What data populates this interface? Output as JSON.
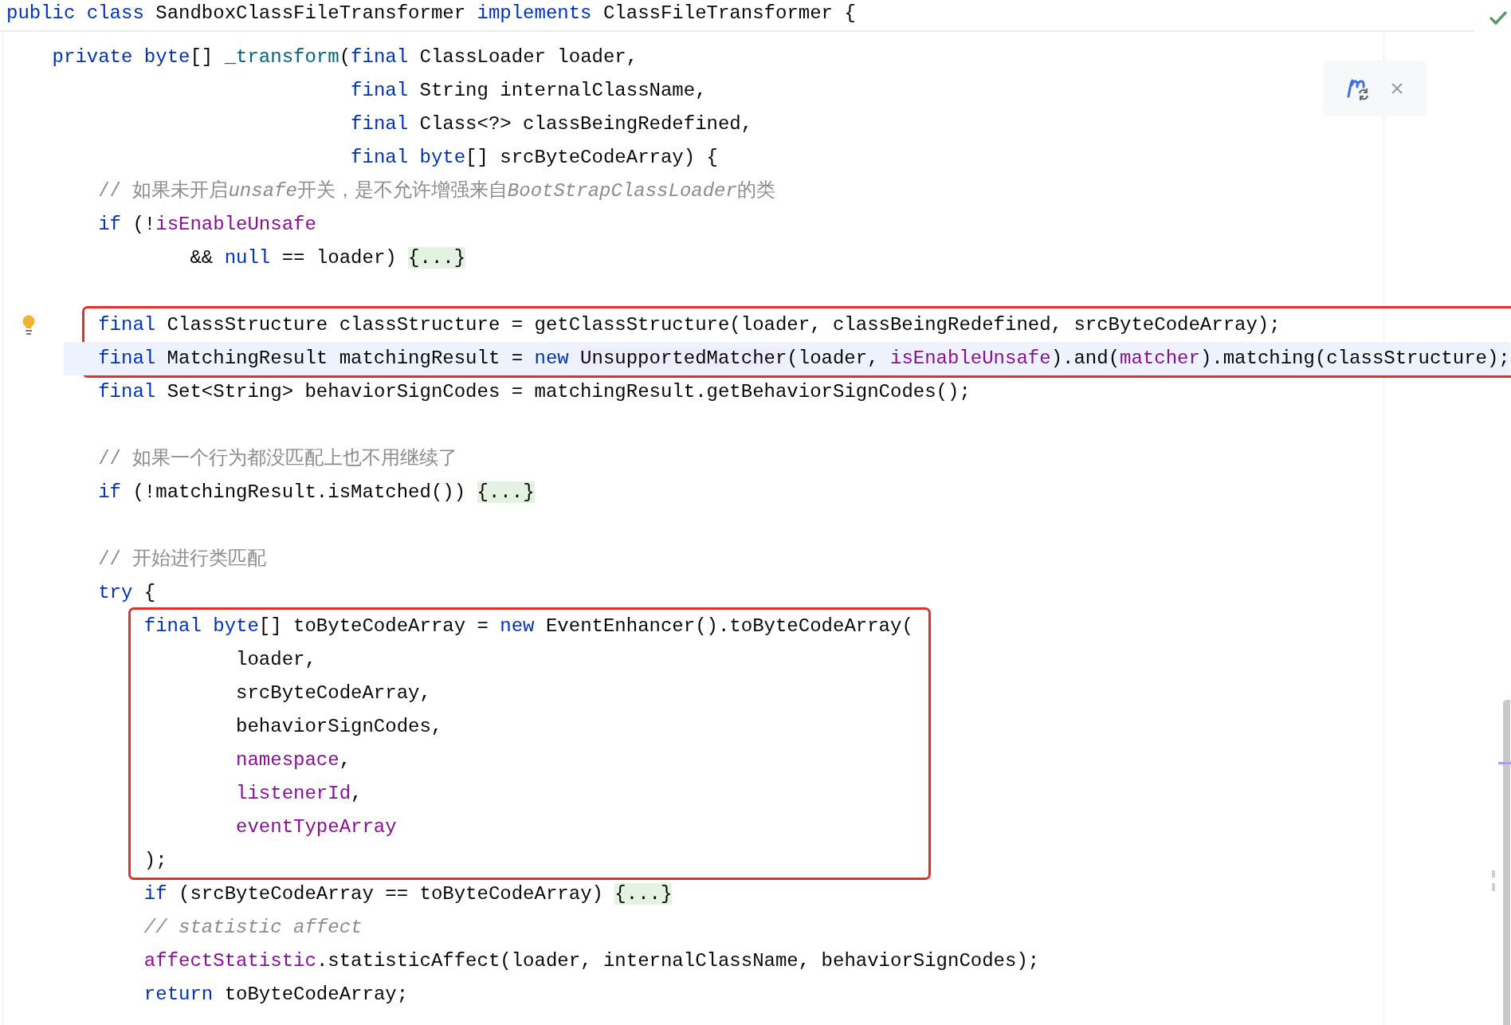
{
  "header": {
    "tokens": [
      {
        "kind": "keyword",
        "text": "public class "
      },
      {
        "kind": "text",
        "text": "SandboxClassFileTransformer "
      },
      {
        "kind": "keyword",
        "text": "implements "
      },
      {
        "kind": "text",
        "text": "ClassFileTransformer {"
      }
    ]
  },
  "rows": [
    {
      "kind": "line",
      "current": false,
      "tokens": [
        {
          "kind": "keyword",
          "text": "    private byte"
        },
        {
          "kind": "text",
          "text": "[] "
        },
        {
          "kind": "method",
          "text": "_transform"
        },
        {
          "kind": "text",
          "text": "("
        },
        {
          "kind": "keyword",
          "text": "final "
        },
        {
          "kind": "text",
          "text": "ClassLoader loader,"
        }
      ]
    },
    {
      "kind": "line",
      "current": false,
      "tokens": [
        {
          "kind": "keyword",
          "text": "                              final "
        },
        {
          "kind": "text",
          "text": "String internalClassName,"
        }
      ]
    },
    {
      "kind": "line",
      "current": false,
      "tokens": [
        {
          "kind": "keyword",
          "text": "                              final "
        },
        {
          "kind": "text",
          "text": "Class<?> classBeingRedefined,"
        }
      ]
    },
    {
      "kind": "line",
      "current": false,
      "tokens": [
        {
          "kind": "keyword",
          "text": "                              final byte"
        },
        {
          "kind": "text",
          "text": "[] srcByteCodeArray) {"
        }
      ]
    },
    {
      "kind": "line",
      "current": false,
      "tokens": [
        {
          "kind": "comment",
          "text": "        // 如果未开启"
        },
        {
          "kind": "comment_italic",
          "text": "unsafe"
        },
        {
          "kind": "comment",
          "text": "开关，是不允许增强来自"
        },
        {
          "kind": "comment_italic",
          "text": "BootStrapClassLoader"
        },
        {
          "kind": "comment",
          "text": "的类"
        }
      ]
    },
    {
      "kind": "line",
      "current": false,
      "tokens": [
        {
          "kind": "keyword",
          "text": "        if"
        },
        {
          "kind": "text",
          "text": " (!"
        },
        {
          "kind": "field",
          "text": "isEnableUnsafe"
        }
      ]
    },
    {
      "kind": "line",
      "current": false,
      "tokens": [
        {
          "kind": "text",
          "text": "                && "
        },
        {
          "kind": "keyword",
          "text": "null"
        },
        {
          "kind": "text",
          "text": " == loader) "
        },
        {
          "kind": "fold",
          "text": "{...}"
        }
      ]
    },
    {
      "kind": "blank"
    },
    {
      "kind": "box",
      "lines": [
        {
          "current": false,
          "bulb": true,
          "tokens": [
            {
              "kind": "keyword",
              "text": "        final"
            },
            {
              "kind": "text",
              "text": " ClassStructure classStructure = getClassStructure(loader, classBeingRedefined, srcByteCodeArray);"
            }
          ]
        },
        {
          "current": true,
          "tokens": [
            {
              "kind": "keyword",
              "text": "        final"
            },
            {
              "kind": "text",
              "text": " MatchingResult matchingResult = "
            },
            {
              "kind": "keyword",
              "text": "new "
            },
            {
              "kind": "usage",
              "text": "UnsupportedMatcher"
            },
            {
              "kind": "text",
              "text": "(loader, "
            },
            {
              "kind": "field",
              "text": "isEnableUnsafe"
            },
            {
              "kind": "text",
              "text": ").and("
            },
            {
              "kind": "field",
              "text": "matcher"
            },
            {
              "kind": "text",
              "text": ").matching(classStructure);"
            }
          ]
        }
      ]
    },
    {
      "kind": "line",
      "current": false,
      "tokens": [
        {
          "kind": "keyword",
          "text": "        final"
        },
        {
          "kind": "text",
          "text": " Set<String> behaviorSignCodes = matchingResult.getBehaviorSignCodes();"
        }
      ]
    },
    {
      "kind": "blank"
    },
    {
      "kind": "line",
      "current": false,
      "tokens": [
        {
          "kind": "comment",
          "text": "        // 如果一个行为都没匹配上也不用继续了"
        }
      ]
    },
    {
      "kind": "line",
      "current": false,
      "tokens": [
        {
          "kind": "keyword",
          "text": "        if"
        },
        {
          "kind": "text",
          "text": " (!matchingResult.isMatched()) "
        },
        {
          "kind": "fold",
          "text": "{...}"
        }
      ]
    },
    {
      "kind": "blank"
    },
    {
      "kind": "line",
      "current": false,
      "tokens": [
        {
          "kind": "comment",
          "text": "        // 开始进行类匹配"
        }
      ]
    },
    {
      "kind": "line",
      "current": false,
      "tokens": [
        {
          "kind": "keyword",
          "text": "        try"
        },
        {
          "kind": "text",
          "text": " {"
        }
      ]
    },
    {
      "kind": "box",
      "lines": [
        {
          "current": false,
          "tokens": [
            {
              "kind": "keyword",
              "text": "            final byte"
            },
            {
              "kind": "text",
              "text": "[] toByteCodeArray = "
            },
            {
              "kind": "keyword",
              "text": "new"
            },
            {
              "kind": "text",
              "text": " EventEnhancer().toByteCodeArray("
            }
          ]
        },
        {
          "current": false,
          "tokens": [
            {
              "kind": "text",
              "text": "                    loader,"
            }
          ]
        },
        {
          "current": false,
          "tokens": [
            {
              "kind": "text",
              "text": "                    srcByteCodeArray,"
            }
          ]
        },
        {
          "current": false,
          "tokens": [
            {
              "kind": "text",
              "text": "                    behaviorSignCodes,"
            }
          ]
        },
        {
          "current": false,
          "tokens": [
            {
              "kind": "field",
              "text": "                    namespace"
            },
            {
              "kind": "text",
              "text": ","
            }
          ]
        },
        {
          "current": false,
          "tokens": [
            {
              "kind": "field",
              "text": "                    listenerId"
            },
            {
              "kind": "text",
              "text": ","
            }
          ]
        },
        {
          "current": false,
          "tokens": [
            {
              "kind": "field",
              "text": "                    eventTypeArray"
            }
          ]
        },
        {
          "current": false,
          "tokens": [
            {
              "kind": "text",
              "text": "            );"
            }
          ]
        }
      ]
    },
    {
      "kind": "line",
      "current": false,
      "tokens": [
        {
          "kind": "keyword",
          "text": "            if"
        },
        {
          "kind": "text",
          "text": " (srcByteCodeArray == toByteCodeArray) "
        },
        {
          "kind": "fold",
          "text": "{...}"
        }
      ]
    },
    {
      "kind": "line",
      "current": false,
      "tokens": [
        {
          "kind": "comment_italic",
          "text": "            // statistic affect"
        }
      ]
    },
    {
      "kind": "line",
      "current": false,
      "tokens": [
        {
          "kind": "field",
          "text": "            affectStatistic"
        },
        {
          "kind": "text",
          "text": ".statisticAffect(loader, internalClassName, behaviorSignCodes);"
        }
      ]
    },
    {
      "kind": "line",
      "current": false,
      "tokens": [
        {
          "kind": "keyword",
          "text": "            return"
        },
        {
          "kind": "text",
          "text": " toByteCodeArray;"
        }
      ]
    }
  ]
}
